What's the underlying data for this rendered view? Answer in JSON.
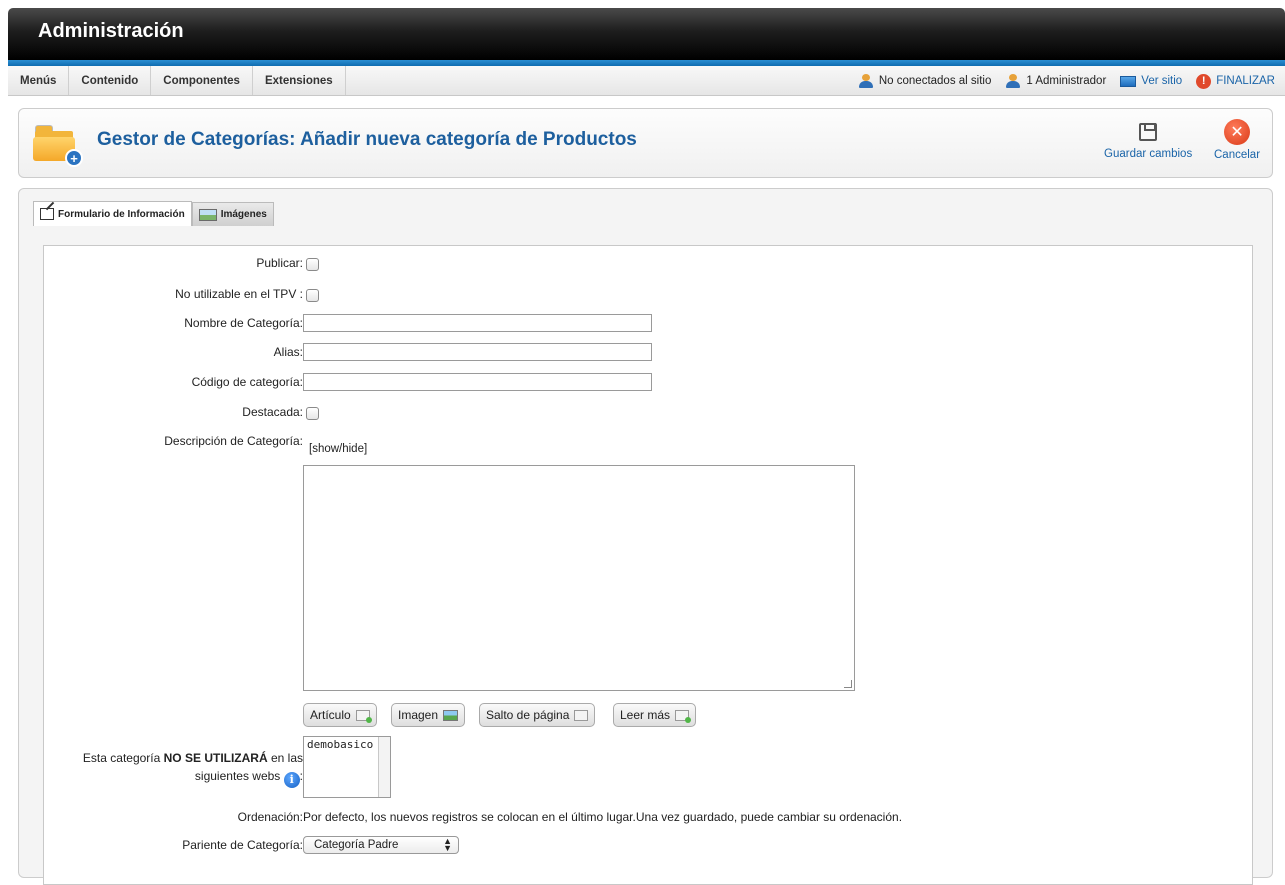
{
  "header": {
    "title": "Administración"
  },
  "menu": {
    "items": [
      "Menús",
      "Contenido",
      "Componentes",
      "Extensiones"
    ]
  },
  "status": {
    "not_connected": "No conectados al sitio",
    "admins": "1 Administrador",
    "view_site": "Ver sitio",
    "logout": "FINALIZAR"
  },
  "toolbar": {
    "title": "Gestor de Categorías: Añadir nueva categoría de Productos",
    "save_label": "Guardar cambios",
    "cancel_label": "Cancelar"
  },
  "tabs": {
    "info": "Formulario de Información",
    "images": "Imágenes"
  },
  "form": {
    "publish_label": "Publicar:",
    "tpv_label": "No utilizable en el TPV :",
    "name_label": "Nombre de Categoría:",
    "name_value": "",
    "alias_label": "Alias:",
    "alias_value": "",
    "code_label": "Código de categoría:",
    "code_value": "",
    "featured_label": "Destacada:",
    "description_label": "Descripción de Categoría:",
    "show_hide": "[show/hide]",
    "editor_buttons": [
      "Artículo",
      "Imagen",
      "Salto de página",
      "Leer más"
    ],
    "webs_label_pre": "Esta categoría ",
    "webs_label_bold": "NO SE UTILIZARÁ",
    "webs_label_post": " en las",
    "webs_label_line2": "siguientes webs",
    "webs_colon": ":",
    "webs_options": [
      "demobasico"
    ],
    "ordering_label": "Ordenación:",
    "ordering_text": "Por defecto, los nuevos registros se colocan en el último lugar.Una vez guardado, puede cambiar su ordenación.",
    "parent_label": "Pariente de Categoría:",
    "parent_value": "Categoría Padre"
  }
}
